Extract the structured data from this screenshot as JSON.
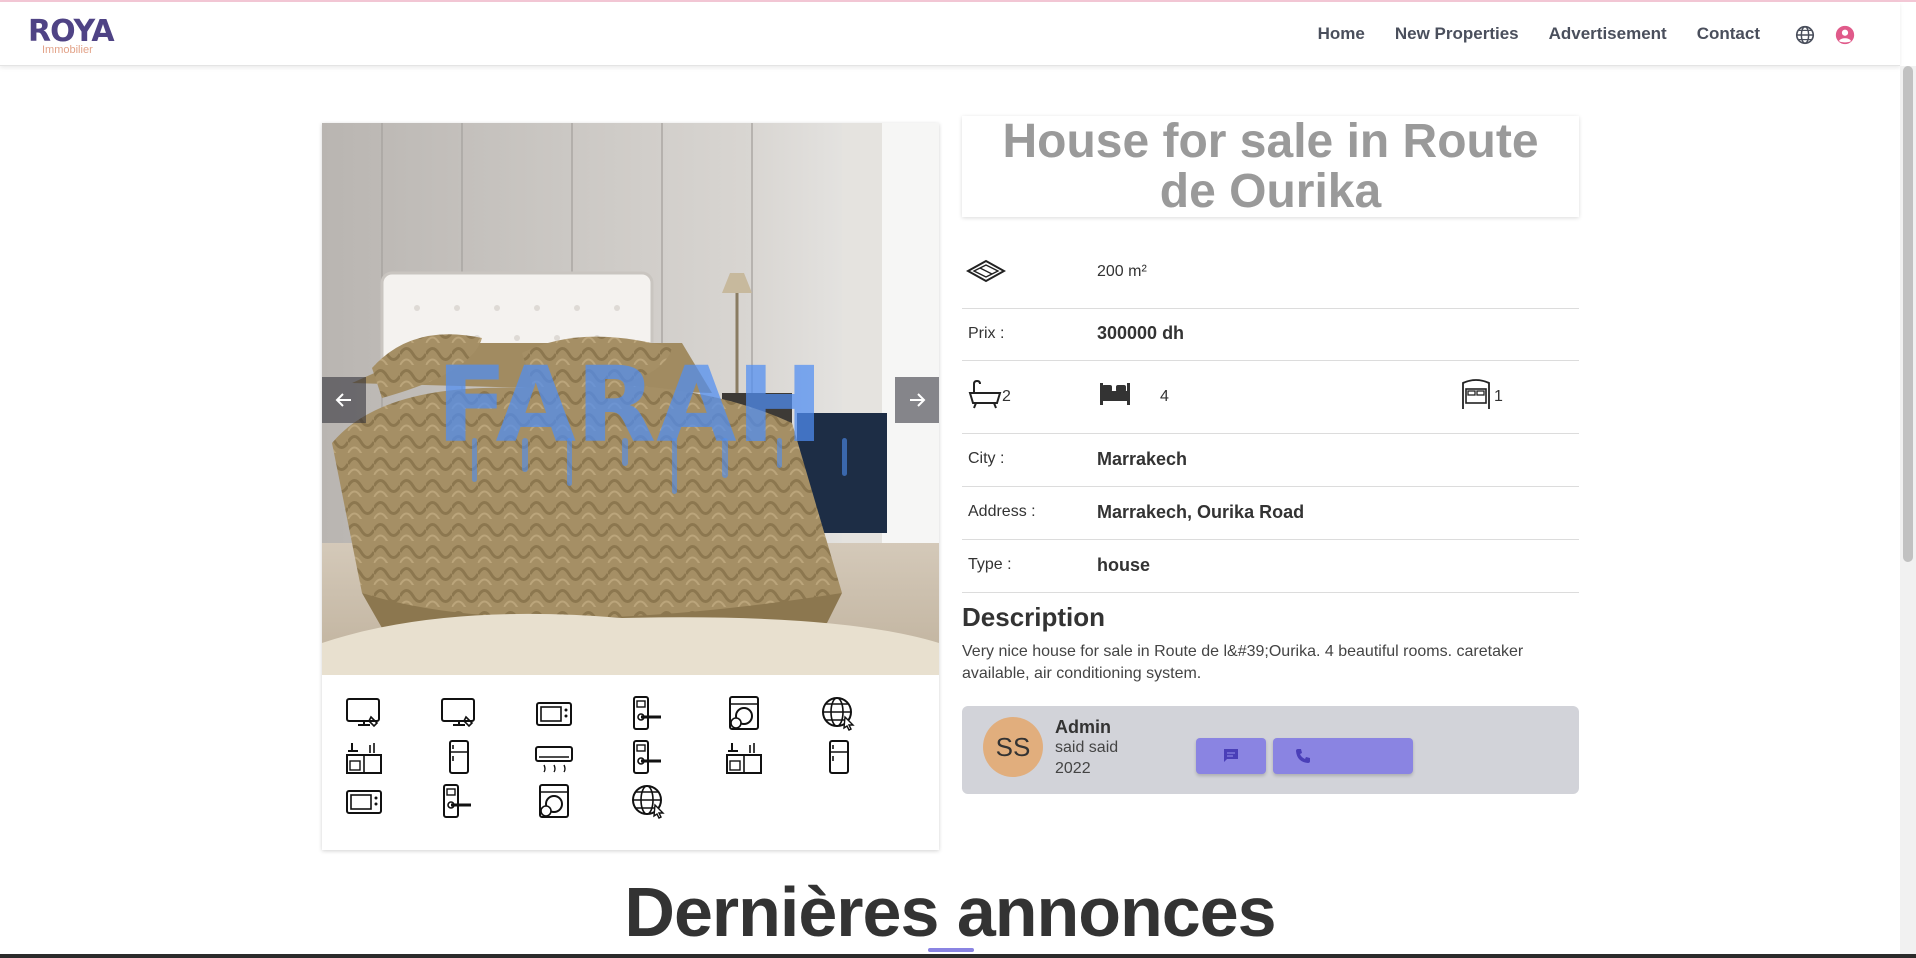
{
  "header": {
    "logo_text": "ROYA",
    "logo_subtext": "Immobilier",
    "nav": [
      "Home",
      "New Properties",
      "Advertisement",
      "Contact"
    ]
  },
  "property": {
    "title": "House for sale in Route de Ourika",
    "area": "200 m²",
    "price_label": "Prix :",
    "price": "300000 dh",
    "bathrooms": "2",
    "bedrooms": "4",
    "rooms": "1",
    "city_label": "City :",
    "city": "Marrakech",
    "address_label": "Address :",
    "address": "Marrakech, Ourika Road",
    "type_label": "Type :",
    "type": "house",
    "watermark": "FARAH"
  },
  "description": {
    "heading": "Description",
    "text": "Very nice house for sale in Route de l&#39;Ourika. 4 beautiful rooms. caretaker available, air conditioning system."
  },
  "agent": {
    "initials": "SS",
    "name": "Admin",
    "line2": "said said",
    "line3": "2022"
  },
  "amenities": [
    "smart-tv-icon",
    "smart-tv-icon",
    "microwave-icon",
    "smart-lock-icon",
    "washing-machine-icon",
    "wifi-globe-icon",
    "kitchen-icon",
    "fridge-icon",
    "air-conditioner-icon",
    "smart-lock-icon",
    "kitchen-icon",
    "fridge-icon",
    "microwave-icon",
    "smart-lock-icon",
    "washing-machine-icon",
    "wifi-globe-icon"
  ],
  "latest_heading": "Dernières annonces",
  "colors": {
    "brand": "#4f4385",
    "accent": "#8a84e2",
    "avatar": "#e1ae7d",
    "user_icon": "#e05a8a"
  }
}
